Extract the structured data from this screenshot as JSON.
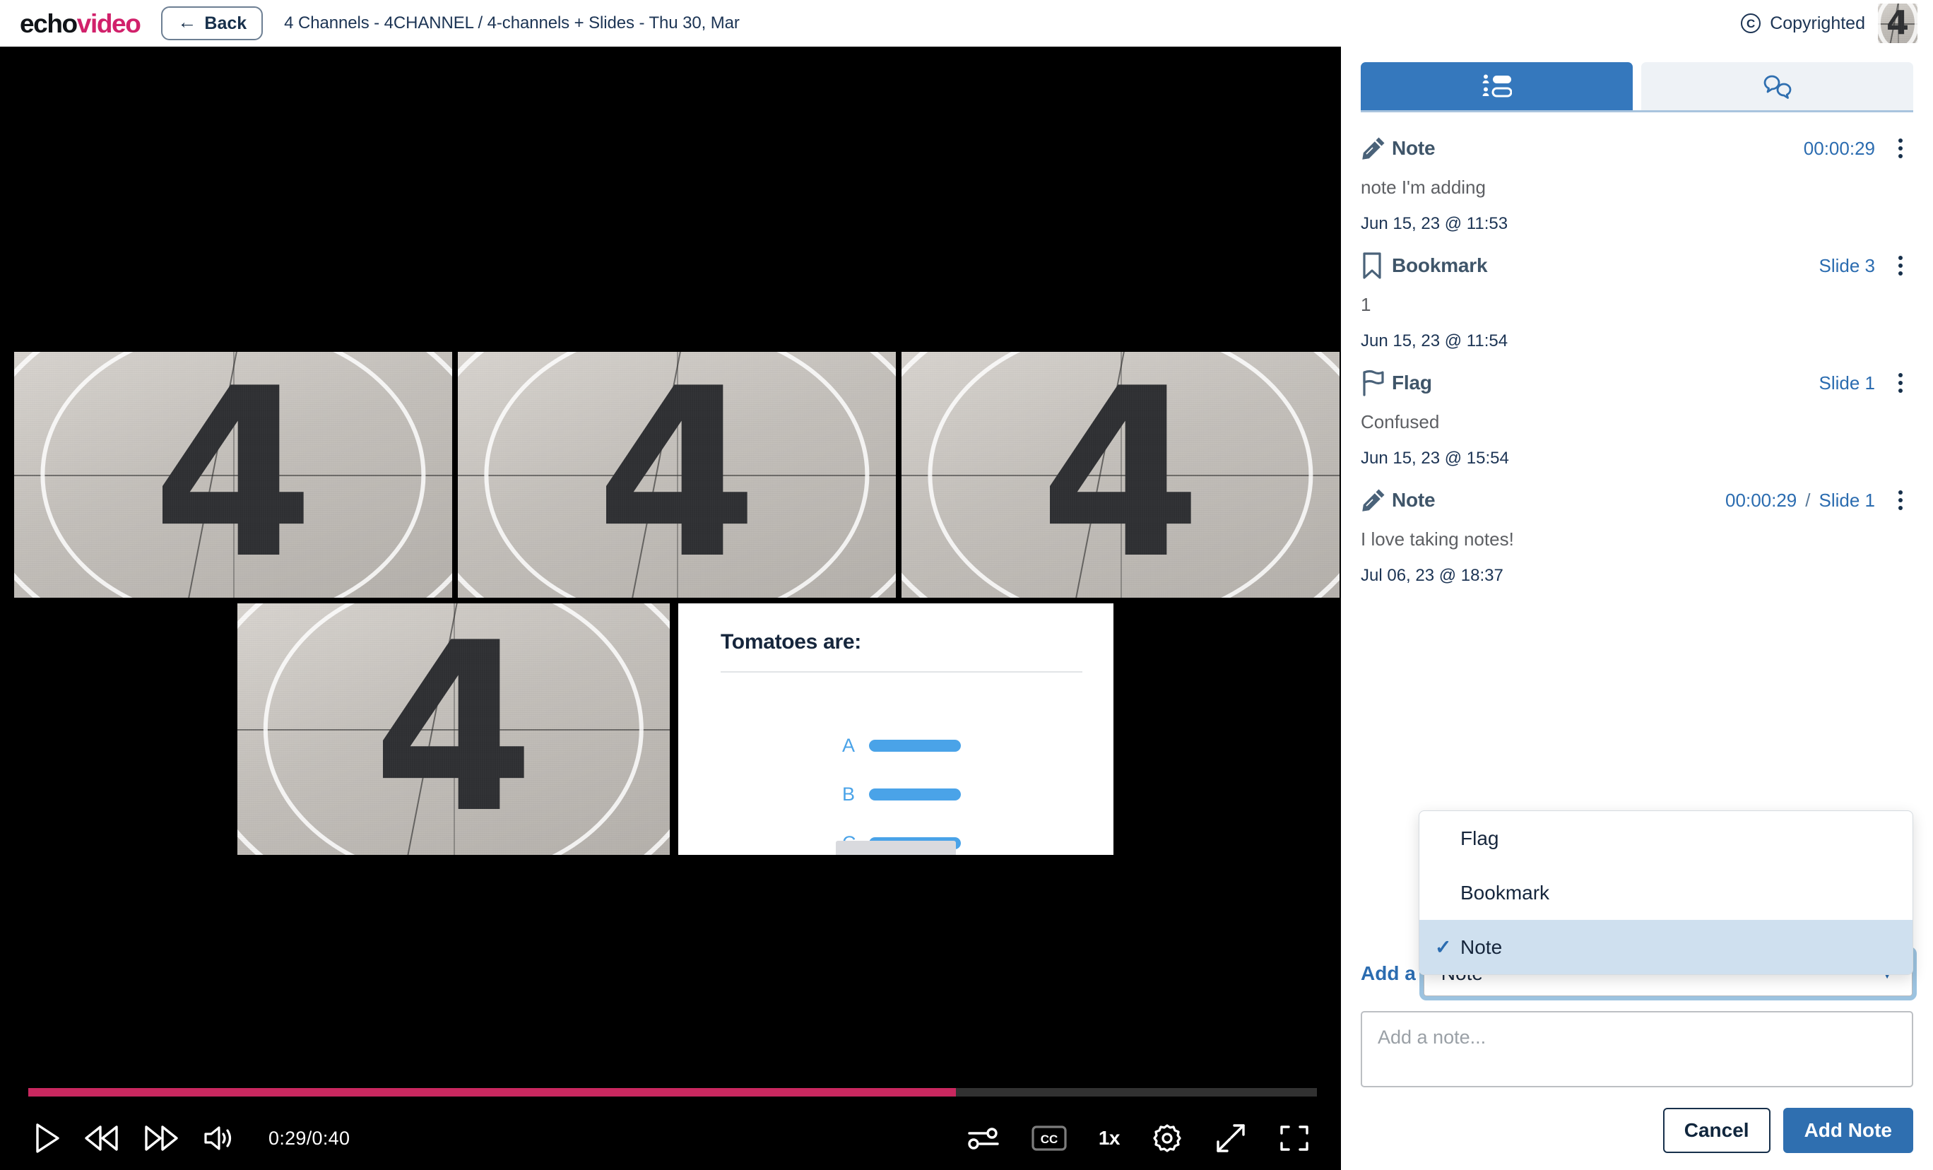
{
  "header": {
    "logo_echo": "echo",
    "logo_video": "video",
    "back_label": "Back",
    "back_icon": "arrow-left-icon",
    "title": "4 Channels - 4CHANNEL / 4-channels + Slides - Thu 30, Mar",
    "copyright_label": "Copyrighted",
    "copyright_icon": "copyright-icon"
  },
  "player": {
    "tiles": [
      {
        "label": "4"
      },
      {
        "label": "4"
      },
      {
        "label": "4"
      },
      {
        "label": "4"
      }
    ],
    "slide": {
      "title": "Tomatoes are:",
      "options": [
        {
          "letter": "A"
        },
        {
          "letter": "B"
        },
        {
          "letter": "C"
        }
      ]
    },
    "controls": {
      "play_icon": "play-icon",
      "rewind_icon": "rewind-icon",
      "forward_icon": "fast-forward-icon",
      "volume_icon": "volume-icon",
      "time_display": "0:29/0:40",
      "current_time": "0:29",
      "duration": "0:40",
      "progress_percent": 72,
      "settings_sliders_icon": "sliders-icon",
      "cc_label": "CC",
      "speed_label": "1x",
      "gear_icon": "gear-icon",
      "expand_icon": "expand-arrows-icon",
      "fullscreen_icon": "fullscreen-icon",
      "progress_color": "#c9285f"
    }
  },
  "sidebar": {
    "tabs": [
      {
        "name": "engagement-tab",
        "icon": "list-people-icon",
        "active": true
      },
      {
        "name": "discussion-tab",
        "icon": "chat-bubbles-icon",
        "active": false
      }
    ],
    "notes": [
      {
        "icon": "pencil-icon",
        "type": "Note",
        "time": "00:00:29",
        "slide": "",
        "body": "note I'm adding",
        "date": "Jun 15, 23 @ 11:53"
      },
      {
        "icon": "bookmark-icon",
        "type": "Bookmark",
        "time": "",
        "slide": "Slide 3",
        "body": "1",
        "date": "Jun 15, 23 @ 11:54"
      },
      {
        "icon": "flag-icon",
        "type": "Flag",
        "time": "",
        "slide": "Slide 1",
        "body": "Confused",
        "date": "Jun 15, 23 @ 15:54"
      },
      {
        "icon": "pencil-icon",
        "type": "Note",
        "time": "00:00:29",
        "slide": "Slide 1",
        "body": "I love taking notes!",
        "date": "Jul 06, 23 @ 18:37"
      }
    ],
    "dropdown": {
      "open": true,
      "options": [
        {
          "label": "Flag",
          "selected": false
        },
        {
          "label": "Bookmark",
          "selected": false
        },
        {
          "label": "Note",
          "selected": true
        }
      ],
      "check_glyph": "✓"
    },
    "compose": {
      "add_label": "Add a",
      "selected_type": "Note",
      "caret_icon": "chevron-down-icon",
      "note_placeholder": "Add a note...",
      "note_value": "",
      "cancel_label": "Cancel",
      "submit_label": "Add Note"
    }
  },
  "colors": {
    "brand_pink": "#d1216b",
    "accent_blue": "#2f6fb0",
    "tab_active": "#3578bd",
    "progress": "#c9285f"
  }
}
